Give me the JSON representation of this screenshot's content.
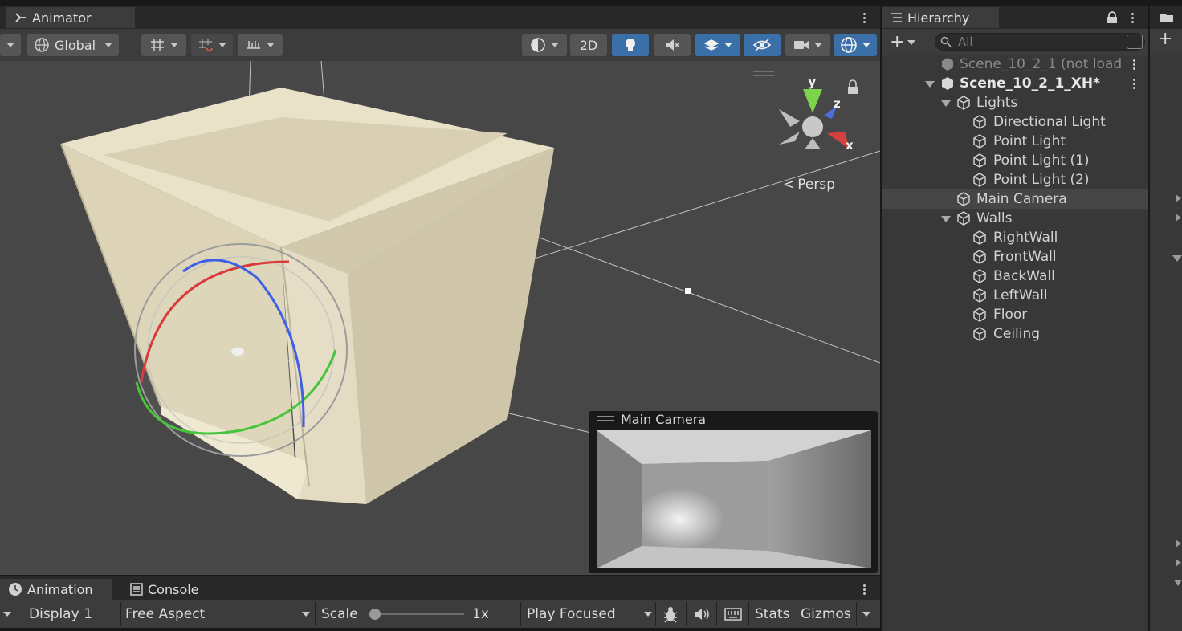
{
  "scene": {
    "tab_label": "Animator",
    "toolbar": {
      "global_label": "Global",
      "twod_label": "2D"
    },
    "view_label": "Persp",
    "axes": {
      "y": "y",
      "z": "z",
      "x": "x"
    },
    "camera_preview_title": "Main Camera"
  },
  "game": {
    "tabs": [
      {
        "label": "Animation"
      },
      {
        "label": "Console"
      }
    ],
    "toolbar": {
      "display": "Display 1",
      "aspect": "Free Aspect",
      "scale_label": "Scale",
      "scale_value": "1x",
      "play_mode": "Play Focused",
      "stats": "Stats",
      "gizmos": "Gizmos"
    }
  },
  "hierarchy": {
    "tab_label": "Hierarchy",
    "search_placeholder": "All",
    "rows": [
      {
        "label": "Scene_10_2_1 (not load"
      },
      {
        "label": "Scene_10_2_1_XH*"
      },
      {
        "label": "Lights"
      },
      {
        "label": "Directional Light"
      },
      {
        "label": "Point Light"
      },
      {
        "label": "Point Light (1)"
      },
      {
        "label": "Point Light (2)"
      },
      {
        "label": "Main Camera"
      },
      {
        "label": "Walls"
      },
      {
        "label": "RightWall"
      },
      {
        "label": "FrontWall"
      },
      {
        "label": "BackWall"
      },
      {
        "label": "LeftWall"
      },
      {
        "label": "Floor"
      },
      {
        "label": "Ceiling"
      }
    ]
  },
  "colors": {
    "accent": "#3a6fa8",
    "wall": "#e6dfc7",
    "selection_row": "#464646",
    "panel": "#383838"
  }
}
